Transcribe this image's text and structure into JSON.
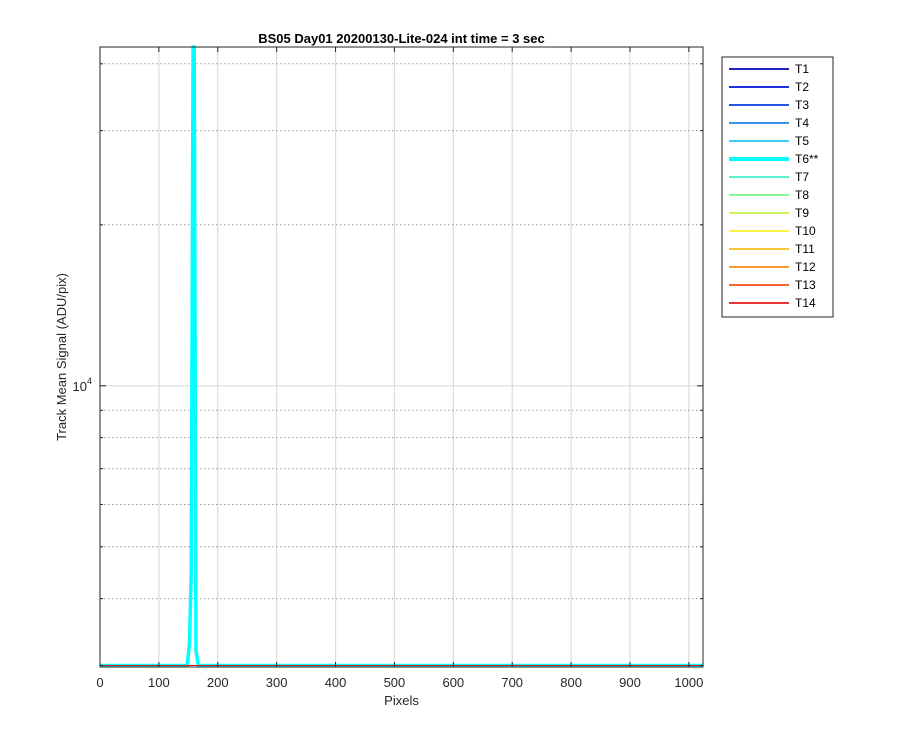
{
  "chart_data": {
    "type": "line",
    "title": "BS05 Day01 20200130-Lite-024 int time = 3 sec",
    "xlabel": "Pixels",
    "ylabel": "Track Mean Signal (ADU/pix)",
    "xlim": [
      0,
      1024
    ],
    "ylim": [
      2980,
      43000
    ],
    "y_scale": "log",
    "x_ticks": [
      0,
      100,
      200,
      300,
      400,
      500,
      600,
      700,
      800,
      900,
      1000
    ],
    "y_major_tick": 10000,
    "y_major_tick_label_base": "10",
    "y_major_tick_label_exp": "4",
    "grid": true,
    "legend_position": "outside-top-right",
    "series": [
      {
        "name": "T1",
        "color": "#0000b3",
        "width": 1,
        "x": [
          0,
          1024
        ],
        "y": [
          3000,
          3000
        ]
      },
      {
        "name": "T2",
        "color": "#0010d9",
        "width": 1,
        "x": [
          0,
          1024
        ],
        "y": [
          3000,
          3000
        ]
      },
      {
        "name": "T3",
        "color": "#0a3ee0",
        "width": 1,
        "x": [
          0,
          1024
        ],
        "y": [
          3000,
          3000
        ]
      },
      {
        "name": "T4",
        "color": "#1a84e6",
        "width": 1,
        "x": [
          0,
          1024
        ],
        "y": [
          3000,
          3000
        ]
      },
      {
        "name": "T5",
        "color": "#22c4f0",
        "width": 1,
        "x": [
          0,
          1024
        ],
        "y": [
          3000,
          3000
        ]
      },
      {
        "name": "T6**",
        "color": "#00ffff",
        "width": 3.5,
        "x": [
          0,
          148,
          152,
          155,
          158,
          160,
          163,
          167,
          1024
        ],
        "y": [
          3000,
          3000,
          3300,
          4500,
          43000,
          43000,
          3200,
          3000,
          3000
        ]
      },
      {
        "name": "T7",
        "color": "#44f0c8",
        "width": 1,
        "x": [
          0,
          1024
        ],
        "y": [
          3000,
          3000
        ]
      },
      {
        "name": "T8",
        "color": "#7ff58a",
        "width": 1,
        "x": [
          0,
          1024
        ],
        "y": [
          3000,
          3000
        ]
      },
      {
        "name": "T9",
        "color": "#c4f54a",
        "width": 1,
        "x": [
          0,
          1024
        ],
        "y": [
          3000,
          3000
        ]
      },
      {
        "name": "T10",
        "color": "#f5f522",
        "width": 1,
        "x": [
          0,
          1024
        ],
        "y": [
          3000,
          3000
        ]
      },
      {
        "name": "T11",
        "color": "#f5c01a",
        "width": 1,
        "x": [
          0,
          1024
        ],
        "y": [
          3000,
          3000
        ]
      },
      {
        "name": "T12",
        "color": "#f58a1a",
        "width": 1,
        "x": [
          0,
          1024
        ],
        "y": [
          3000,
          3000
        ]
      },
      {
        "name": "T13",
        "color": "#f5501a",
        "width": 1,
        "x": [
          0,
          1024
        ],
        "y": [
          3000,
          3000
        ]
      },
      {
        "name": "T14",
        "color": "#e01a1a",
        "width": 1,
        "x": [
          0,
          1024
        ],
        "y": [
          3000,
          3000
        ]
      }
    ]
  }
}
